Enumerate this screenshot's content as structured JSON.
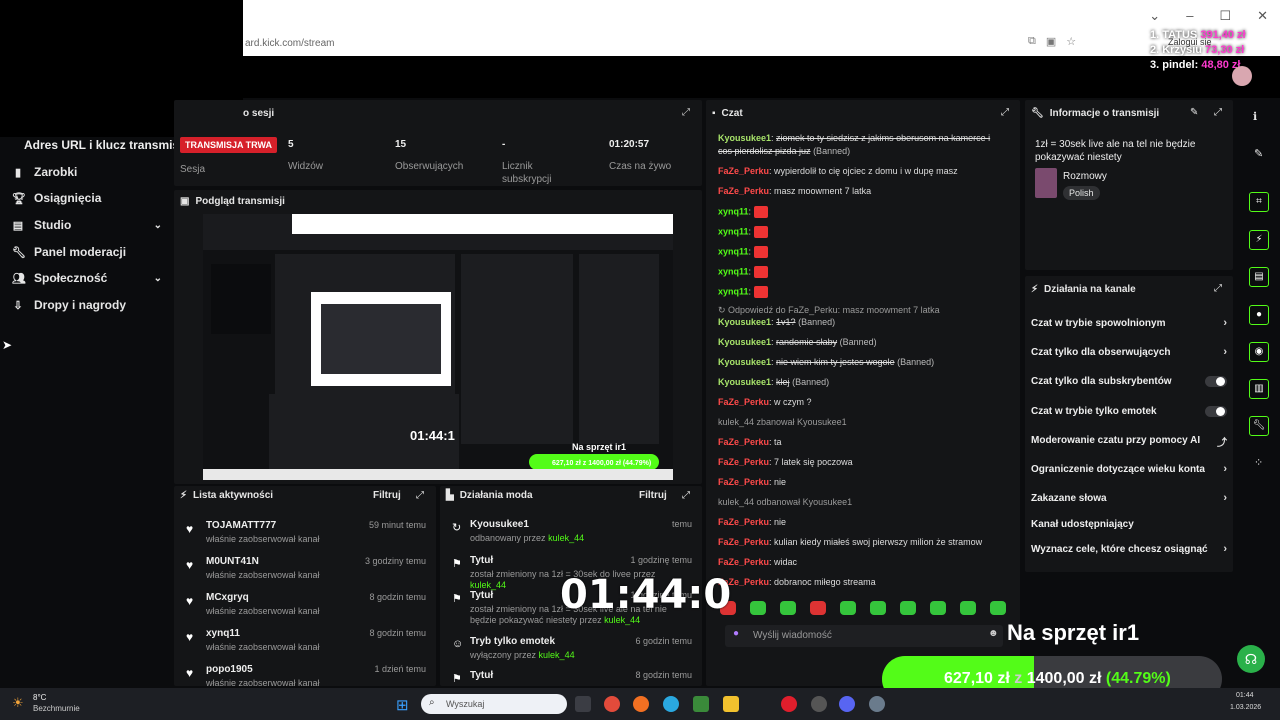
{
  "browser": {
    "url": "ard.kick.com/stream",
    "login_label": "Zalogui się"
  },
  "donations": [
    {
      "rank": "1. TATUS",
      "amount": "391,40 zł"
    },
    {
      "rank": "2. Krzysiu",
      "amount": "73,30 zł"
    },
    {
      "rank": "3. pindel:",
      "amount": "48,80 zł"
    }
  ],
  "sidebar": {
    "header": "Adres URL i klucz transmisji",
    "items": [
      {
        "label": "Zarobki",
        "icon": "stats-icon",
        "chevron": false
      },
      {
        "label": "Osiągnięcia",
        "icon": "trophy-icon",
        "chevron": false
      },
      {
        "label": "Studio",
        "icon": "studio-icon",
        "chevron": true
      },
      {
        "label": "Panel moderacji",
        "icon": "wrench-icon",
        "chevron": false
      },
      {
        "label": "Społeczność",
        "icon": "community-icon",
        "chevron": true
      },
      {
        "label": "Dropy i nagrody",
        "icon": "drops-icon",
        "chevron": false
      }
    ]
  },
  "session": {
    "title": "o sesji",
    "status": "TRANSMISJA TRWA",
    "status_label": "Sesja",
    "stats": [
      {
        "value": "5",
        "label": "Widzów"
      },
      {
        "value": "15",
        "label": "Obserwujących"
      },
      {
        "value": "-",
        "label": "Licznik subskrypcji"
      },
      {
        "value": "01:20:57",
        "label": "Czas na żywo"
      }
    ]
  },
  "preview": {
    "title": "Podgląd transmisji",
    "timer": "01:44:1",
    "tag": "Na sprzęt ir1",
    "goal": "627,10 zł z 1400,00 zł (44.79%)"
  },
  "activity": {
    "title": "Lista aktywności",
    "filter": "Filtruj",
    "items": [
      {
        "name": "TOJAMATT777",
        "action": "właśnie zaobserwował kanał",
        "time": "59 minut temu"
      },
      {
        "name": "M0UNT41N",
        "action": "właśnie zaobserwował kanał",
        "time": "3 godziny temu"
      },
      {
        "name": "MCxgryq",
        "action": "właśnie zaobserwował kanał",
        "time": "8 godzin temu"
      },
      {
        "name": "xynq11",
        "action": "właśnie zaobserwował kanał",
        "time": "8 godzin temu"
      },
      {
        "name": "popo1905",
        "action": "właśnie zaobserwował kanał",
        "time": "1 dzień temu"
      }
    ]
  },
  "mod_actions": {
    "title": "Działania moda",
    "filter": "Filtruj",
    "items": [
      {
        "title": "Kyousukee1",
        "desc": "odbanowany przez",
        "by": "kulek_44",
        "time": "temu"
      },
      {
        "title": "Tytuł",
        "desc": "został zmieniony na 1zł = 30sek do livee przez",
        "by": "kulek_44",
        "time": "1 godzinę temu"
      },
      {
        "title": "Tytuł",
        "desc": "został zmieniony na 1zł = 30sek live ale na tel nie będzie pokazywać niestety przez",
        "by": "kulek_44",
        "time": "1 godzinę temu"
      },
      {
        "title": "Tryb tylko emotek",
        "desc": "wyłączony przez",
        "by": "kulek_44",
        "time": "6 godzin temu"
      },
      {
        "title": "Tytuł",
        "desc": "",
        "by": "",
        "time": "8 godzin temu"
      }
    ]
  },
  "chat": {
    "title": "Czat",
    "lines": [
      {
        "user": "Kyousukee1",
        "type": "kyo",
        "text": "ziomek to ty siedzisz z jakims oberusom na kamerce i",
        "strike": true,
        "banned": false
      },
      {
        "user": "",
        "type": "cont",
        "text": "cos pierdolisz pizda juz",
        "strike": true,
        "banned": true
      },
      {
        "user": "FaZe_Perku",
        "type": "faze",
        "text": "wypierdolił to cię ojciec z domu i w dupę masz",
        "strike": false,
        "banned": false
      },
      {
        "user": "FaZe_Perku",
        "type": "faze",
        "text": "masz moowment 7 latka",
        "strike": false,
        "banned": false
      },
      {
        "user": "xynq11",
        "type": "xyn",
        "text": "",
        "emote": true
      },
      {
        "user": "xynq11",
        "type": "xyn",
        "text": "",
        "emote": true
      },
      {
        "user": "xynq11",
        "type": "xyn",
        "text": "",
        "emote": true
      },
      {
        "user": "xynq11",
        "type": "xyn",
        "text": "",
        "emote": true
      },
      {
        "user": "xynq11",
        "type": "xyn",
        "text": "",
        "emote": true
      },
      {
        "user": "",
        "type": "sys",
        "text": "↻ Odpowiedź do FaZe_Perku: masz moowment 7 latka"
      },
      {
        "user": "Kyousukee1",
        "type": "kyo",
        "text": "1v1?",
        "strike": true,
        "banned": true
      },
      {
        "user": "Kyousukee1",
        "type": "kyo",
        "text": "randomie słaby",
        "strike": true,
        "banned": true
      },
      {
        "user": "Kyousukee1",
        "type": "kyo",
        "text": "nie wiem kim ty jestes wogole",
        "strike": true,
        "banned": true
      },
      {
        "user": "Kyousukee1",
        "type": "kyo",
        "text": "klej",
        "strike": true,
        "banned": true
      },
      {
        "user": "FaZe_Perku",
        "type": "faze",
        "text": "w czym ?",
        "strike": false,
        "banned": false
      },
      {
        "user": "",
        "type": "sys",
        "text": "kulek_44 zbanował Kyousukee1"
      },
      {
        "user": "FaZe_Perku",
        "type": "faze",
        "text": "ta"
      },
      {
        "user": "FaZe_Perku",
        "type": "faze",
        "text": "7 latek się poczowa"
      },
      {
        "user": "FaZe_Perku",
        "type": "faze",
        "text": "nie"
      },
      {
        "user": "",
        "type": "sys",
        "text": "kulek_44 odbanował Kyousukee1"
      },
      {
        "user": "FaZe_Perku",
        "type": "faze",
        "text": "nie"
      },
      {
        "user": "FaZe_Perku",
        "type": "faze",
        "text": "kulian kiedy miałeś swoj pierwszy milion że stramow"
      },
      {
        "user": "FaZe_Perku",
        "type": "faze",
        "text": "widac"
      },
      {
        "user": "FaZe_Perku",
        "type": "faze",
        "text": "dobranoc miłego streama"
      }
    ],
    "banned_label": "(Banned)",
    "input_placeholder": "Wyślij wiadomość"
  },
  "info": {
    "title": "Informacje o transmisji",
    "stream_title": "1zł = 30sek live ale na tel nie będzie pokazywać niestety",
    "category": "Rozmowy",
    "language": "Polish"
  },
  "channel_actions": {
    "title": "Działania na kanale",
    "items": [
      {
        "label": "Czat w trybie spowolnionym",
        "control": "chevron"
      },
      {
        "label": "Czat tylko dla obserwujących",
        "control": "chevron"
      },
      {
        "label": "Czat tylko dla subskrybentów",
        "control": "toggle"
      },
      {
        "label": "Czat w trybie tylko emotek",
        "control": "toggle"
      },
      {
        "label": "Moderowanie czatu przy pomocy AI",
        "control": "external"
      },
      {
        "label": "Ograniczenie dotyczące wieku konta",
        "control": "chevron"
      },
      {
        "label": "Zakazane słowa",
        "control": "chevron"
      },
      {
        "label": "Kanał udostępniający",
        "control": "none"
      },
      {
        "label": "Wyznacz cele, które chcesz osiągnąć",
        "control": "chevron"
      }
    ]
  },
  "overlay": {
    "timer": "01:44:0",
    "sprzet": "Na sprzęt ir1",
    "goal_current": "627,10 zł",
    "goal_sep": "z",
    "goal_target": "1400,00 zł",
    "goal_pct": "(44.79%)",
    "goal_fraction": 0.4479
  },
  "taskbar": {
    "weather_temp": "8°C",
    "weather_desc": "Bezchmurnie",
    "search": "Wyszukaj",
    "clock_time": "01:44",
    "clock_date": "1.03.2026"
  },
  "colors": {
    "accent": "#53fc18",
    "live": "#d6202a",
    "donation": "#ff3ad0"
  }
}
